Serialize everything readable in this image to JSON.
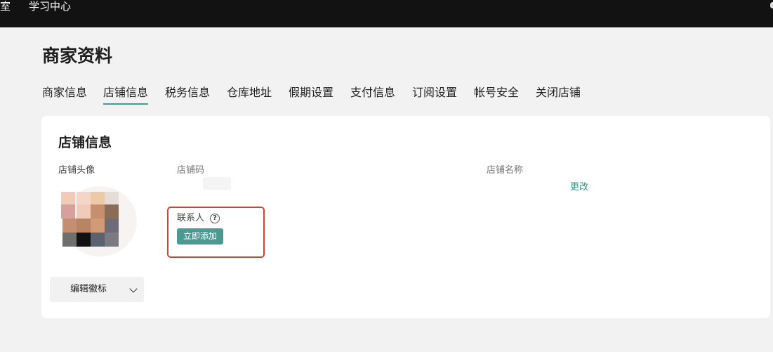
{
  "topbar": {
    "nav_cut_label": "室",
    "nav_learning_label": "学习中心"
  },
  "page": {
    "title": "商家资料"
  },
  "tabs": [
    {
      "label": "商家信息",
      "active": false
    },
    {
      "label": "店铺信息",
      "active": true
    },
    {
      "label": "税务信息",
      "active": false
    },
    {
      "label": "仓库地址",
      "active": false
    },
    {
      "label": "假期设置",
      "active": false
    },
    {
      "label": "支付信息",
      "active": false
    },
    {
      "label": "订阅设置",
      "active": false
    },
    {
      "label": "帐号安全",
      "active": false
    },
    {
      "label": "关闭店铺",
      "active": false
    }
  ],
  "store_card": {
    "title": "店铺信息",
    "avatar_label": "店铺头像",
    "store_code_label": "店铺码",
    "store_name_label": "店铺名称",
    "change_link": "更改",
    "contact_label": "联系人",
    "help_glyph": "?",
    "add_now_button": "立即添加",
    "edit_logo_button": "编辑徽标"
  },
  "colors": {
    "accent": "#4a9a93",
    "highlight": "#d84030",
    "topbar": "#121212"
  },
  "icons": [
    "help-icon",
    "chevron-down-icon"
  ]
}
